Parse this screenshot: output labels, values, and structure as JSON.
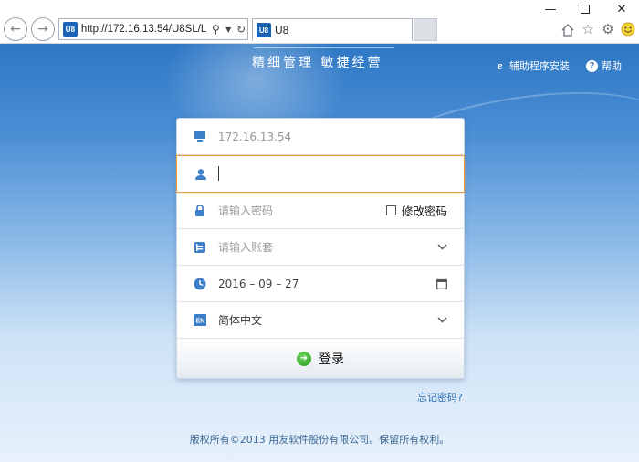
{
  "browser": {
    "address": "http://172.16.13.54/U8SL/L",
    "tab_title": "U8",
    "favicon_text": "U8",
    "icons": [
      "back-icon",
      "forward-icon",
      "search-icon",
      "dropdown-icon",
      "refresh-icon",
      "home-icon",
      "star-icon",
      "gear-icon",
      "smiley-icon",
      "minimize-icon",
      "maximize-icon",
      "close-icon"
    ]
  },
  "header": {
    "slogan": "精细管理   敏捷经营",
    "install_link": "辅助程序安装",
    "help_link": "帮助"
  },
  "login": {
    "server": "172.16.13.54",
    "username_value": "",
    "password_placeholder": "请输入密码",
    "change_password": "修改密码",
    "account_placeholder": "请输入账套",
    "date": "2016 – 09 – 27",
    "language": "简体中文",
    "language_badge": "EN",
    "submit": "登录"
  },
  "forgot": "忘记密码?",
  "footer": "版权所有©2013 用友软件股份有限公司。保留所有权利。",
  "colors": {
    "accent_blue": "#3d7fc8",
    "focus_orange": "#e8a046",
    "go_green": "#259c1e"
  }
}
